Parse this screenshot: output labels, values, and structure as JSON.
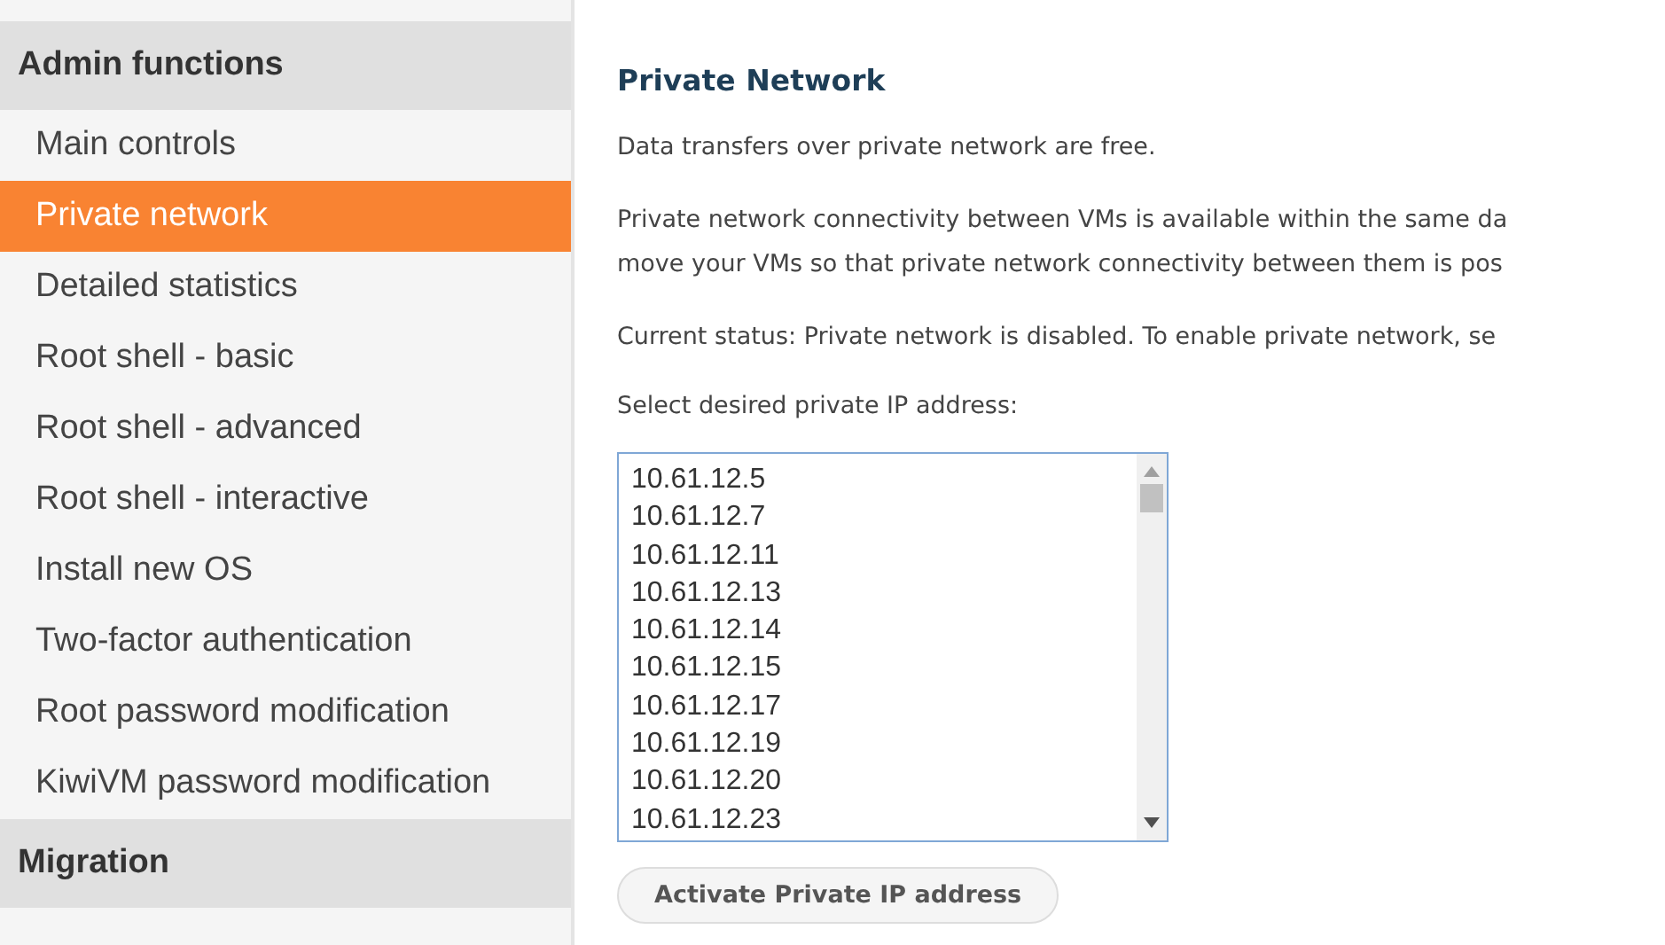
{
  "sidebar": {
    "sections": [
      {
        "title": "Admin functions",
        "items": [
          {
            "label": "Main controls",
            "selected": false
          },
          {
            "label": "Private network",
            "selected": true
          },
          {
            "label": "Detailed statistics",
            "selected": false
          },
          {
            "label": "Root shell - basic",
            "selected": false
          },
          {
            "label": "Root shell - advanced",
            "selected": false
          },
          {
            "label": "Root shell - interactive",
            "selected": false
          },
          {
            "label": "Install new OS",
            "selected": false
          },
          {
            "label": "Two-factor authentication",
            "selected": false
          },
          {
            "label": "Root password modification",
            "selected": false
          },
          {
            "label": "KiwiVM password modification",
            "selected": false
          }
        ]
      },
      {
        "title": "Migration"
      }
    ]
  },
  "main": {
    "heading": "Private Network",
    "paragraphs": [
      [
        "Data transfers over private network are free."
      ],
      [
        "Private network connectivity between VMs is available within the same da",
        "move your VMs so that private network connectivity between them is pos"
      ],
      [
        "Current status: Private network is disabled. To enable private network, se"
      ]
    ],
    "select_label": "Select desired private IP address:",
    "ip_list": [
      "10.61.12.5",
      "10.61.12.7",
      "10.61.12.11",
      "10.61.12.13",
      "10.61.12.14",
      "10.61.12.15",
      "10.61.12.17",
      "10.61.12.19",
      "10.61.12.20",
      "10.61.12.23"
    ],
    "activate_button": "Activate Private IP address"
  }
}
